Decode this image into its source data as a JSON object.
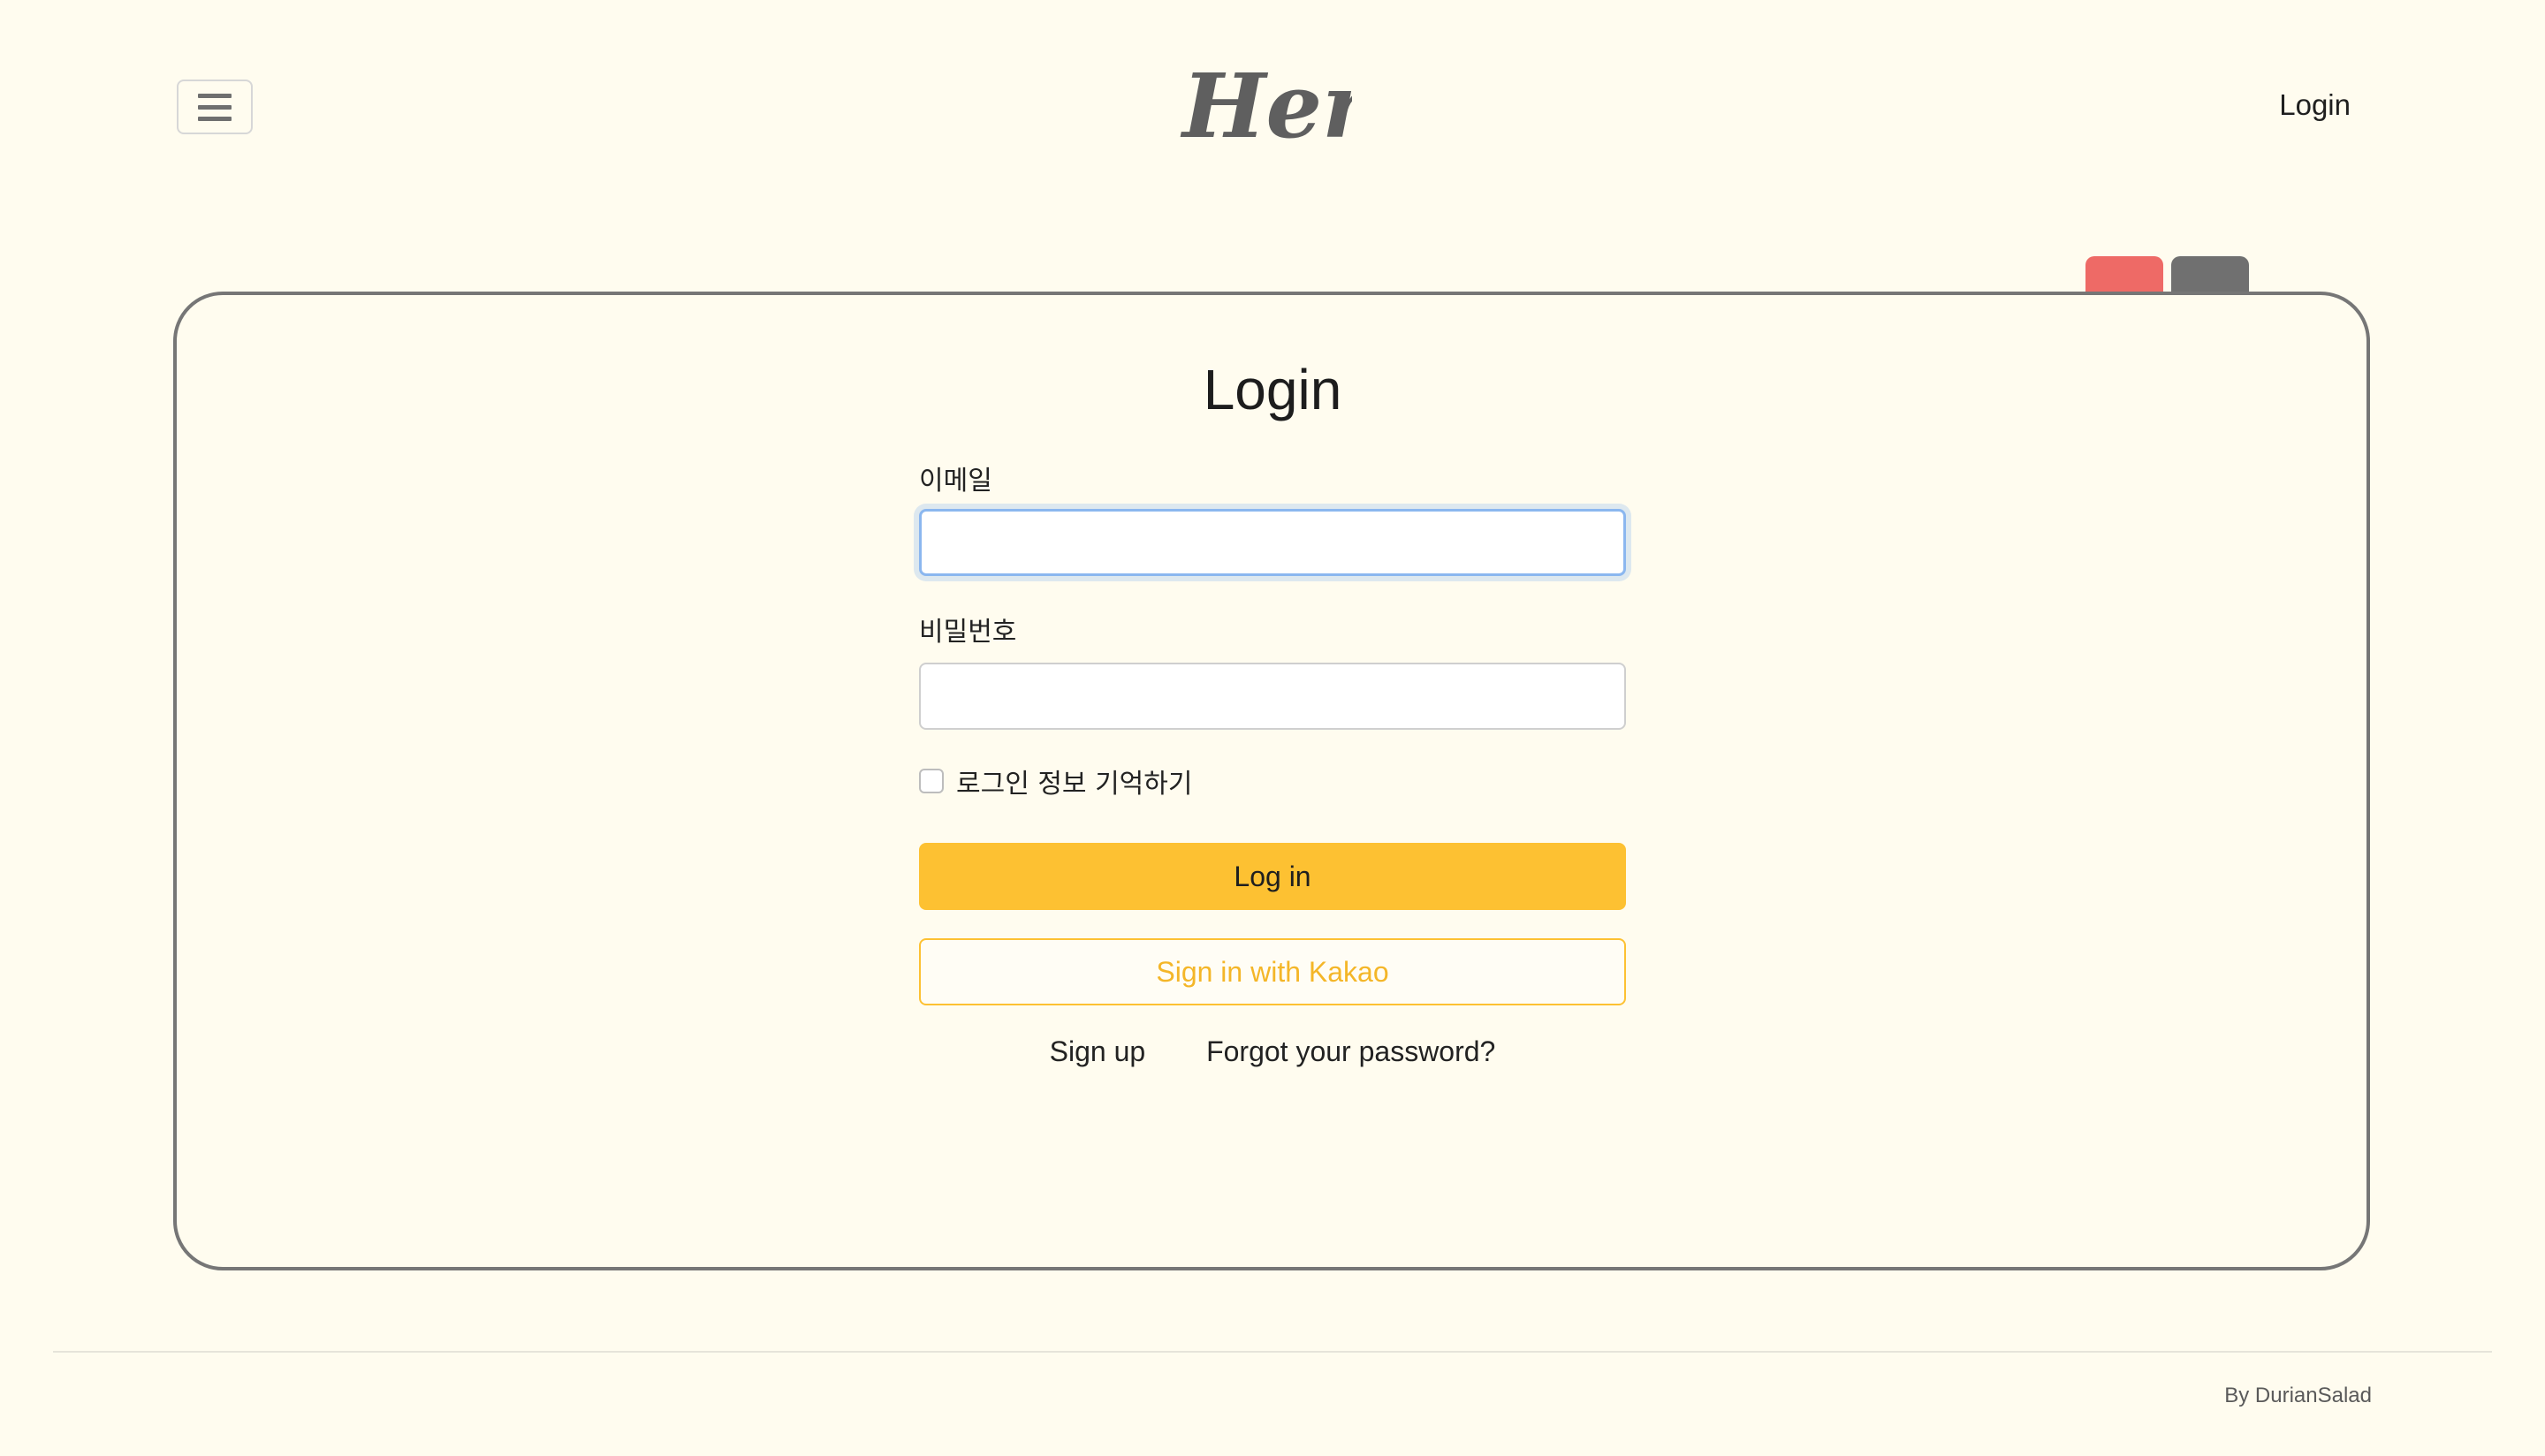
{
  "header": {
    "logo_text": "Hertz",
    "login_link": "Login"
  },
  "login": {
    "title": "Login",
    "email_label": "이메일",
    "email_value": "",
    "password_label": "비밀번호",
    "password_value": "",
    "remember_label": "로그인 정보 기억하기",
    "remember_checked": false,
    "login_button": "Log in",
    "kakao_button": "Sign in with Kakao",
    "signup_link": "Sign up",
    "forgot_link": "Forgot your password?"
  },
  "tabs": {
    "red_color": "#ee6a66",
    "gray_color": "#707070"
  },
  "colors": {
    "background": "#fffcef",
    "accent": "#fdc132",
    "card_border": "#767676"
  },
  "footer": {
    "credit": "By DurianSalad"
  }
}
